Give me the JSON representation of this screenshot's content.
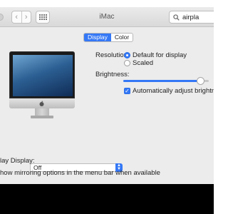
{
  "window": {
    "title": "iMac",
    "nav": {
      "back_glyph": "‹",
      "forward_glyph": "›"
    },
    "search": {
      "value": "airpla",
      "icon": "search-icon"
    }
  },
  "tabs": [
    {
      "label": "Display",
      "selected": true
    },
    {
      "label": "Color",
      "selected": false
    }
  ],
  "display": {
    "resolution_label": "Resolution:",
    "resolution_options": [
      {
        "label": "Default for display",
        "selected": true
      },
      {
        "label": "Scaled",
        "selected": false
      }
    ],
    "brightness_label": "Brightness:",
    "brightness_level": 0.9,
    "auto_brightness": {
      "label": "Automatically adjust brightness",
      "checked": true
    }
  },
  "airplay": {
    "label": "lay Display:",
    "value": "Off",
    "mirroring_text": "how mirroring options in the menu bar when available"
  },
  "colors": {
    "accent": "#3478f6",
    "window_bg": "#ececec"
  }
}
